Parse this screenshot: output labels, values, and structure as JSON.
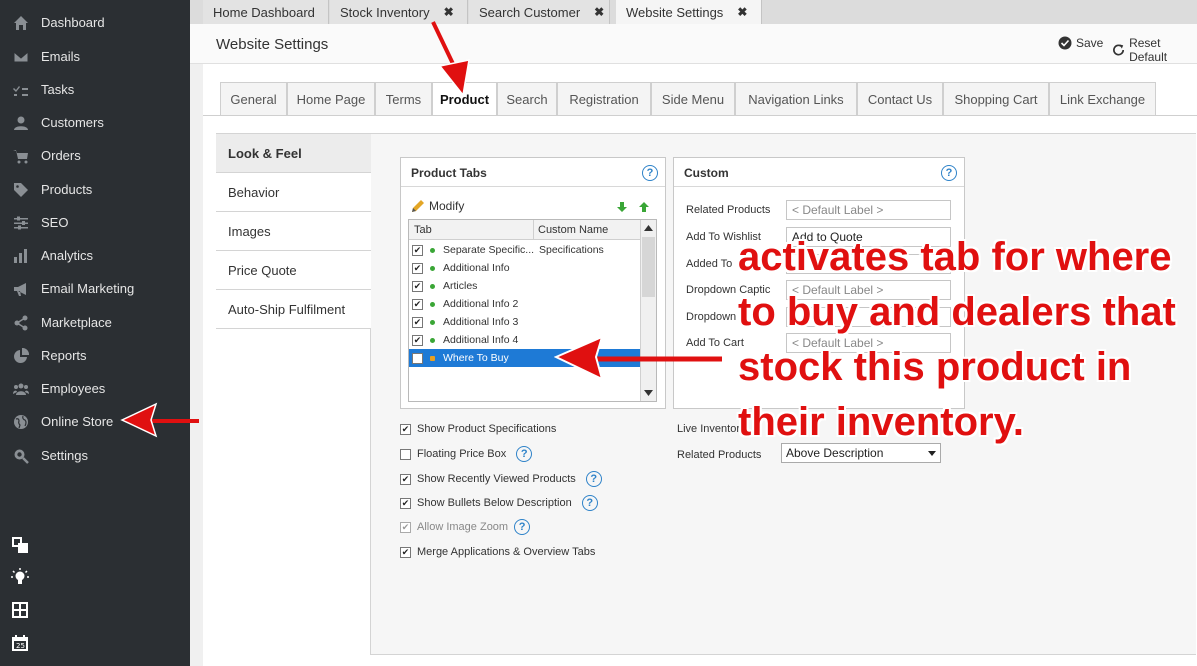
{
  "sidebar": {
    "items": [
      {
        "label": "Dashboard",
        "icon": "home-icon"
      },
      {
        "label": "Emails",
        "icon": "envelope-icon"
      },
      {
        "label": "Tasks",
        "icon": "tasks-icon"
      },
      {
        "label": "Customers",
        "icon": "user-icon"
      },
      {
        "label": "Orders",
        "icon": "cart-icon"
      },
      {
        "label": "Products",
        "icon": "tag-icon"
      },
      {
        "label": "SEO",
        "icon": "sliders-icon"
      },
      {
        "label": "Analytics",
        "icon": "bar-chart-icon"
      },
      {
        "label": "Email Marketing",
        "icon": "megaphone-icon"
      },
      {
        "label": "Marketplace",
        "icon": "share-icon"
      },
      {
        "label": "Reports",
        "icon": "pie-chart-icon"
      },
      {
        "label": "Employees",
        "icon": "group-icon"
      },
      {
        "label": "Online Store",
        "icon": "globe-icon"
      },
      {
        "label": "Settings",
        "icon": "gear-search-icon"
      }
    ],
    "bottom_icons": [
      "layers-icon",
      "lightbulb-icon",
      "grid-list-icon",
      "calendar-icon"
    ]
  },
  "top_tabs": [
    {
      "label": "Home Dashboard",
      "closable": false,
      "active": false
    },
    {
      "label": "Stock Inventory",
      "closable": true,
      "active": false
    },
    {
      "label": "Search Customer",
      "closable": true,
      "active": false
    },
    {
      "label": "Website Settings",
      "closable": true,
      "active": true
    }
  ],
  "close_glyph": "✖",
  "header": {
    "title": "Website Settings",
    "save_label": "Save",
    "reset_label": "Reset Default"
  },
  "settings_tabs": [
    "General",
    "Home Page",
    "Terms",
    "Product",
    "Search",
    "Registration",
    "Side Menu",
    "Navigation Links",
    "Contact Us",
    "Shopping Cart",
    "Link Exchange"
  ],
  "active_settings_tab": "Product",
  "subnav": [
    "Look & Feel",
    "Behavior",
    "Images",
    "Price Quote",
    "Auto-Ship Fulfilment"
  ],
  "active_subnav": "Look & Feel",
  "product_tabs_panel": {
    "title": "Product Tabs",
    "modify_label": "Modify",
    "columns": [
      "Tab",
      "Custom Name"
    ],
    "rows": [
      {
        "checked": true,
        "tab": "Separate Specific...",
        "custom_name": "Specifications",
        "status": "green"
      },
      {
        "checked": true,
        "tab": "Additional Info",
        "custom_name": "",
        "status": "green"
      },
      {
        "checked": true,
        "tab": "Articles",
        "custom_name": "",
        "status": "green"
      },
      {
        "checked": true,
        "tab": "Additional Info 2",
        "custom_name": "",
        "status": "green"
      },
      {
        "checked": true,
        "tab": "Additional Info 3",
        "custom_name": "",
        "status": "green"
      },
      {
        "checked": true,
        "tab": "Additional Info 4",
        "custom_name": "",
        "status": "green"
      },
      {
        "checked": false,
        "tab": "Where To Buy",
        "custom_name": "",
        "status": "orange",
        "selected": true
      }
    ]
  },
  "custom_panel": {
    "title": "Custom",
    "fields": [
      {
        "label": "Related Products",
        "value": "< Default Label >"
      },
      {
        "label": "Add To Wishlist",
        "value": "Add to Quote"
      },
      {
        "label": "Added To",
        "value": ""
      },
      {
        "label": "Dropdown Captic",
        "value": "< Default Label >"
      },
      {
        "label": "Dropdown",
        "value": "th"
      },
      {
        "label": "Add To Cart",
        "value": "< Default Label >"
      }
    ]
  },
  "checkboxes": [
    {
      "label": "Show Product Specifications",
      "checked": true,
      "help": false,
      "disabled": false
    },
    {
      "label": "Floating Price Box",
      "checked": false,
      "help": true,
      "disabled": false
    },
    {
      "label": "Show Recently Viewed Products",
      "checked": true,
      "help": true,
      "disabled": false
    },
    {
      "label": "Show Bullets Below Description",
      "checked": true,
      "help": true,
      "disabled": false
    },
    {
      "label": "Allow Image Zoom",
      "checked": true,
      "help": true,
      "disabled": true
    },
    {
      "label": "Merge Applications & Overview Tabs",
      "checked": true,
      "help": false,
      "disabled": false
    }
  ],
  "live_inventory_label": "Live Inventory",
  "related_products_label": "Related Products",
  "related_products_select": "Above Description",
  "annotation_text": "activates tab for where to buy and dealers that stock this product in their inventory.",
  "help_glyph": "?",
  "check_glyph": "✔",
  "colors": {
    "sidebar": "#2b2f33",
    "accent": "#2f83c9",
    "annotation": "#e01010",
    "selected_row": "#1e7ad6"
  }
}
